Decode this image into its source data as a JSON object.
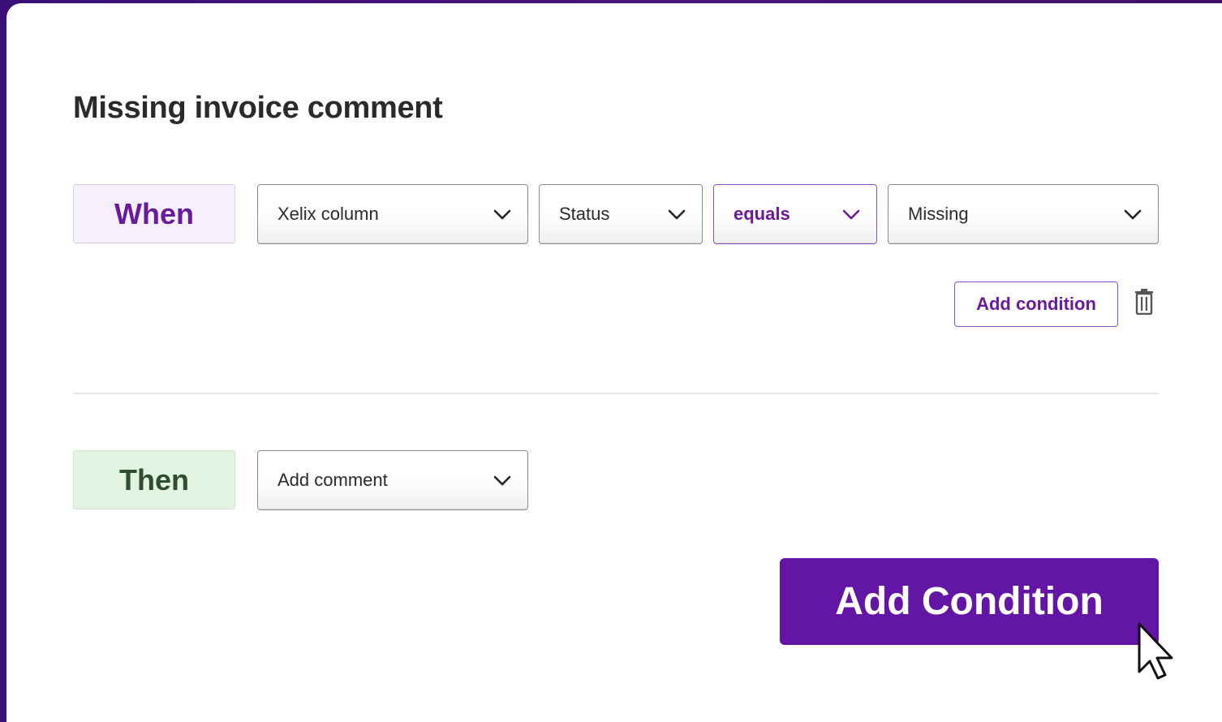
{
  "rule": {
    "title": "Missing invoice comment"
  },
  "when": {
    "label": "When",
    "selects": [
      {
        "value": "Xelix column"
      },
      {
        "value": "Status"
      },
      {
        "value": "equals"
      },
      {
        "value": "Missing"
      }
    ],
    "add_condition_label": "Add condition",
    "delete_icon": "trash-icon"
  },
  "then": {
    "label": "Then",
    "action": {
      "value": "Add comment"
    }
  },
  "footer": {
    "add_condition_label": "Add Condition"
  },
  "colors": {
    "accent": "#6315a6",
    "when_bg": "#f6f0fc",
    "then_bg": "#e3f3e2"
  },
  "icons": {
    "dropdown": "chevron-down-icon",
    "delete": "trash-icon",
    "pointer": "mouse-cursor-icon"
  }
}
